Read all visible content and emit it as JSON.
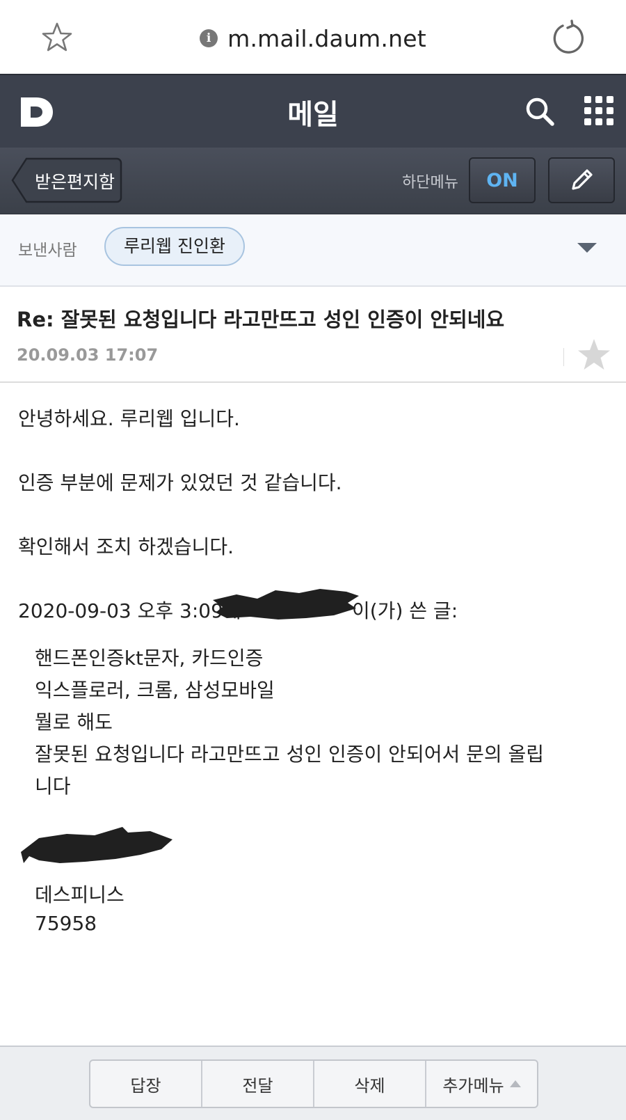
{
  "browser": {
    "url": "m.mail.daum.net",
    "icons": [
      "bookmark-star-icon",
      "info-icon",
      "reload-icon"
    ]
  },
  "header": {
    "title": "메일",
    "logo": "D",
    "icons": [
      "daum-logo-icon",
      "search-icon",
      "apps-grid-icon"
    ]
  },
  "toolbar": {
    "back_label": "받은편지함",
    "bottom_menu_label": "하단메뉴",
    "on_label": "ON",
    "edit_icon": "pencil-icon"
  },
  "sender": {
    "label": "보낸사람",
    "name": "루리웹 진인환"
  },
  "mail": {
    "subject": "Re: 잘못된 요청입니다 라고만뜨고 성인 인증이 안되네요",
    "date": "20.09.03 17:07",
    "body": {
      "greeting": "안녕하세요. 루리웹 입니다.",
      "line2": "인증 부분에 문제가 있었던 것 같습니다.",
      "line3": "확인해서 조치 하겠습니다.",
      "quote_header_prefix": "2020-09-03 오후 3:09에",
      "quote_header_suffix": "이(가) 쓴 글:",
      "quote_lines": [
        "핸드폰인증kt문자, 카드인증",
        "익스플로러, 크롬, 삼성모바일",
        "뭘로 해도",
        "잘못된 요청입니다 라고만뜨고 성인 인증이 안되어서 문의 올립",
        "니다"
      ],
      "signature_lines": [
        "데스피니스",
        "75958"
      ]
    }
  },
  "actions": {
    "reply": "답장",
    "forward": "전달",
    "delete": "삭제",
    "more": "추가메뉴"
  },
  "colors": {
    "header_bg": "#3c414d",
    "accent_on": "#5fb4f2",
    "sender_chip_bg": "#e8f0f9"
  }
}
